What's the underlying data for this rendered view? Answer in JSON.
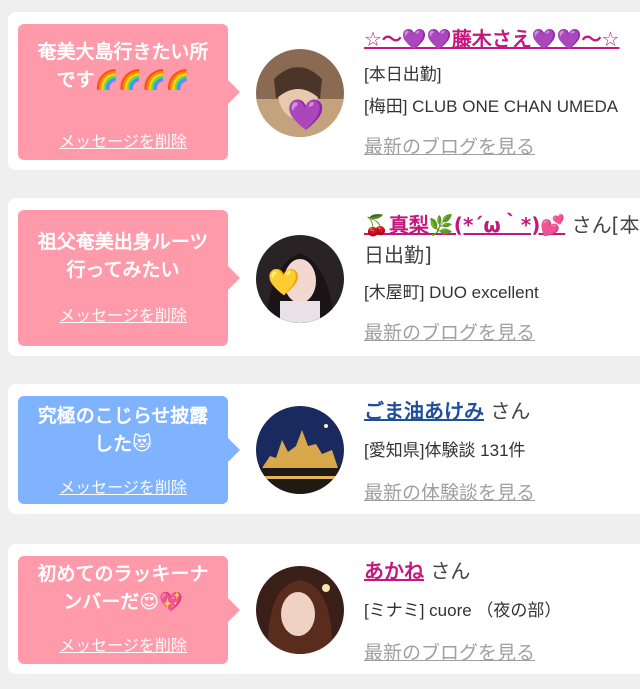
{
  "cards": [
    {
      "message": "奄美大島行きたい所\nです🌈🌈🌈🌈",
      "delete_label": "メッセージを削除",
      "name": "☆〜💜💜藤木さえ💜💜〜☆",
      "name_suffix": "",
      "info1": "[本日出勤]",
      "info2": "[梅田] CLUB ONE CHAN UMEDA",
      "more_label": "最新のブログを見る",
      "bubble_color": "pink"
    },
    {
      "message": "祖父奄美出身ルーツ\n行ってみたい",
      "delete_label": "メッセージを削除",
      "name": "🍒真梨🌿(*´ω｀*)💕",
      "name_suffix": " さん[本日出勤]",
      "info1": "",
      "info2": "[木屋町] DUO excellent",
      "more_label": "最新のブログを見る",
      "bubble_color": "pink"
    },
    {
      "message": "究極のこじらせ披露\nした😻",
      "delete_label": "メッセージを削除",
      "name": "ごま油あけみ",
      "name_suffix": " さん",
      "info1": "[愛知県]体験談 131件",
      "info2": "",
      "more_label": "最新の体験談を見る",
      "bubble_color": "blue"
    },
    {
      "message": "初めてのラッキーナ\nンバーだ😍💖",
      "delete_label": "メッセージを削除",
      "name": "あかね",
      "name_suffix": " さん",
      "info1": "[ミナミ] cuore （夜の部）",
      "info2": "",
      "more_label": "最新のブログを見る",
      "bubble_color": "pink"
    }
  ],
  "colors": {
    "pink_bubble": "#ff9aaa",
    "blue_bubble": "#7fb2ff",
    "name_magenta": "#c4187d",
    "name_navy": "#1f4f99",
    "link_gray": "#a0a0a0"
  }
}
